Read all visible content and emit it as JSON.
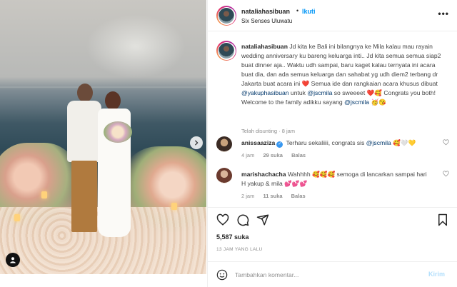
{
  "post": {
    "username": "nataliahasibuan",
    "separator": "•",
    "follow_label": "Ikuti",
    "location": "Six Senses Uluwatu",
    "more_label": "•••",
    "caption": {
      "username": "nataliahasibuan",
      "part1": "Jd kita ke Bali ini bilangnya ke Mila kalau mau rayain wedding anniversary ku bareng keluarga inti.. Jd kita semua semua siap2 buat dinner aja.. Waktu udh sampai, baru kaget kalau ternyata ini acara buat dia, dan ada semua keluarga dan sahabat yg udh diem2 terbang dr Jakarta buat acara ini ",
      "emoji1": "❤️",
      "part2": " Semua ide dan rangkaian acara khusus dibuat ",
      "mention1": "@yakuphasibuan",
      "part3": " untuk ",
      "mention2": "@jscmila",
      "part4": " so sweeeet ",
      "emoji2": "❤️🥰",
      "part5": " Congrats you both! Welcome to the family adikku sayang ",
      "mention3": "@jscmila",
      "emoji3": " 🥳😘",
      "edited": "Telah disunting · 8 jam"
    },
    "comments": [
      {
        "username": "anissaaziza",
        "text": " Terharu sekaliiii, congrats sis ",
        "mention": "@jscmila",
        "emoji": " 🥰🤍💛",
        "time": "4 jam",
        "likes": "29 suka",
        "reply": "Balas"
      },
      {
        "username": "marishachacha",
        "text": " Wahhhh ",
        "emoji_a": "🥰🥰🥰",
        "text2": " semoga di lancarkan sampai hari H yakup & mila ",
        "emoji_b": "💕💕💕",
        "time": "2 jam",
        "likes": "11 suka",
        "reply": "Balas"
      }
    ],
    "likes": "5,587 suka",
    "time_ago": "13 JAM YANG LALU",
    "comment_placeholder": "Tambahkan komentar...",
    "send_label": "Kirim"
  },
  "colors": {
    "accent": "#0095f6",
    "mention": "#00376b",
    "muted": "#8e8e8e",
    "send_disabled": "#b2dffc"
  },
  "icons": {
    "heart": "heart-icon",
    "comment": "comment-icon",
    "share": "share-icon",
    "save": "bookmark-icon",
    "emoji": "emoji-icon",
    "next": "chevron-right-icon",
    "tag": "user-tag-icon",
    "verified": "verified-badge-icon"
  }
}
